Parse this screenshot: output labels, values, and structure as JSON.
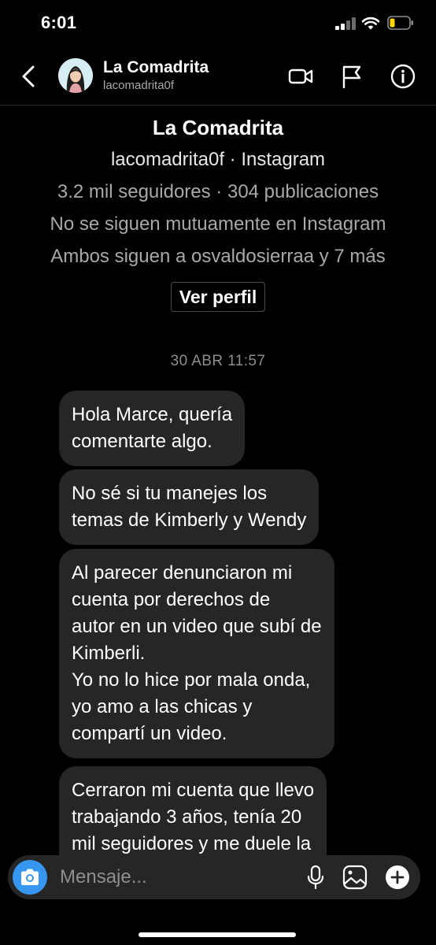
{
  "status_bar": {
    "time": "6:01"
  },
  "header": {
    "name": "La Comadrita",
    "username": "lacomadrita0f"
  },
  "profile": {
    "name": "La Comadrita",
    "handle_line": "lacomadrita0f · Instagram",
    "stats": "3.2 mil seguidores · 304 publicaciones",
    "mutual": "No se siguen mutuamente en Instagram",
    "followed_by": "Ambos siguen a osvaldosierraa y 7 más",
    "view_profile_label": "Ver perfil"
  },
  "thread": {
    "timestamp": "30 ABR 11:57",
    "messages": [
      {
        "text": "Hola Marce, quería\ncomentarte algo."
      },
      {
        "text": "No sé si tu manejes los\ntemas de Kimberly y Wendy"
      },
      {
        "text": "Al parecer denunciaron mi\ncuenta por derechos de\nautor en un video que subí de\nKimberli.\nYo no lo hice por mala onda,\nyo amo a las chicas y\ncompartí un video."
      },
      {
        "text": "Cerraron mi cuenta que llevo\ntrabajando 3 años, tenía 20\nmil seguidores y me duele la"
      }
    ]
  },
  "composer": {
    "placeholder": "Mensaje..."
  },
  "icons": {
    "back": "chevron-left-icon",
    "video_call": "video-camera-icon",
    "report": "flag-icon",
    "info": "info-icon",
    "camera": "camera-icon",
    "mic": "microphone-icon",
    "gallery": "gallery-icon",
    "add": "plus-circle-icon"
  },
  "colors": {
    "background": "#000000",
    "bubble": "#262626",
    "camera_button": "#3797f0",
    "secondary_text": "#a8a8a8"
  }
}
